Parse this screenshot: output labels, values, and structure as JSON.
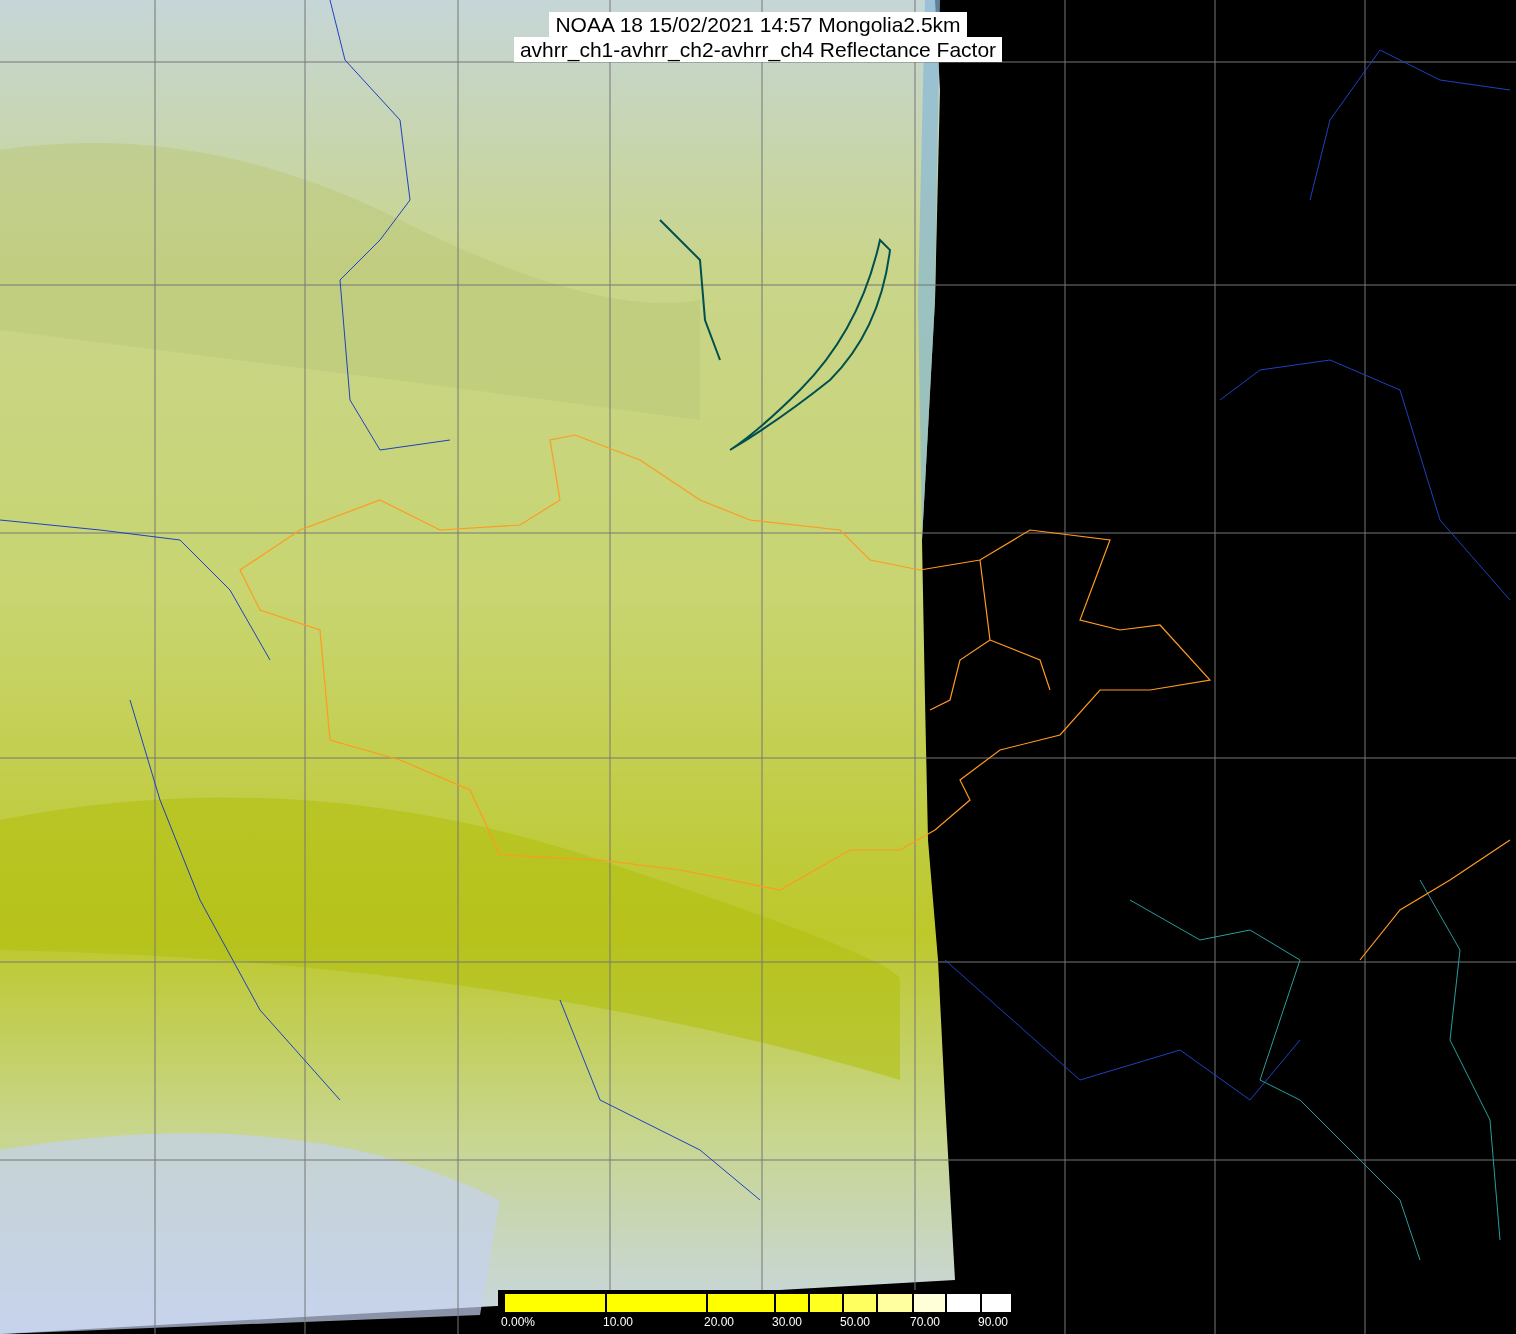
{
  "title": {
    "lines": [
      "NOAA 18 15/02/2021 14:57 Mongolia2.5km",
      "avhrr_ch1-avhrr_ch2-avhrr_ch4 Reflectance Factor"
    ]
  },
  "colorbar": {
    "segments": [
      {
        "color": "#ffff00",
        "label": "0.00%"
      },
      {
        "color": "#ffff00",
        "label": "10.00"
      },
      {
        "color": "#ffff00",
        "label": "20.00"
      },
      {
        "color": "#ffff00",
        "label": "30.00"
      },
      {
        "color": "#ffff20"
      },
      {
        "color": "#ffff60",
        "label": "50.00"
      },
      {
        "color": "#ffffa0"
      },
      {
        "color": "#ffffd8",
        "label": "70.00"
      },
      {
        "color": "#ffffff"
      },
      {
        "color": "#ffffff",
        "label": "90.00"
      }
    ]
  }
}
